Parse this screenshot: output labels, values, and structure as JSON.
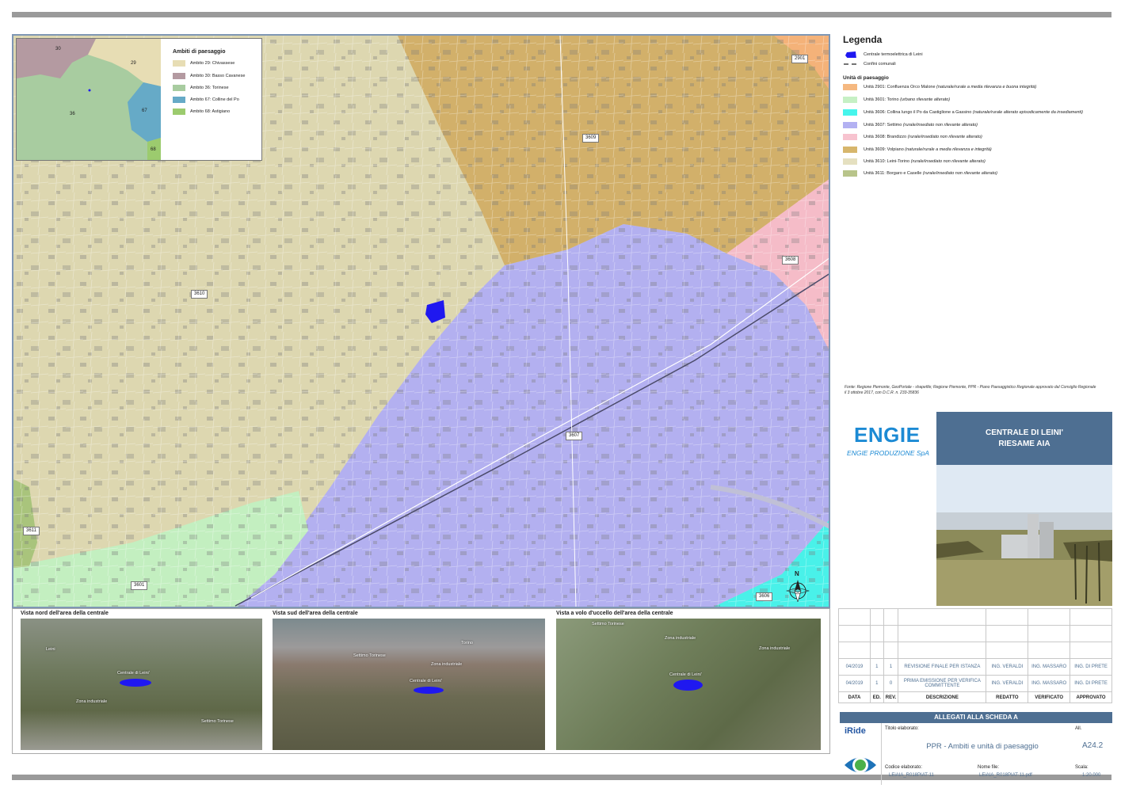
{
  "map": {
    "unit_labels": [
      "3610",
      "3609",
      "3607",
      "3608",
      "3601",
      "3611",
      "3606",
      "2901"
    ],
    "north_label": "N"
  },
  "inset": {
    "title": "Ambiti di paesaggio",
    "numbers": [
      "30",
      "29",
      "36",
      "67",
      "68"
    ],
    "items": [
      {
        "label": "Ambito 29: Chivassese",
        "color": "#e7ddb4"
      },
      {
        "label": "Ambito 30: Basso Cavanese",
        "color": "#b49aa1"
      },
      {
        "label": "Ambito 36: Torinese",
        "color": "#a8cca0"
      },
      {
        "label": "Ambito 67: Colline del Po",
        "color": "#66aac7"
      },
      {
        "label": "Ambito 68: Astigiano",
        "color": "#9ccb6e"
      }
    ]
  },
  "legend": {
    "title": "Legenda",
    "centrale": "Centrale termoelettrica di Leini",
    "confini": "Confini comunali",
    "units_title": "Unità di paesaggio",
    "units": [
      {
        "label": "Unità 2901: Confluenza Orco Malone",
        "note": "(naturale/rurale a media rilevanza e buona integrità)",
        "color": "#f5b880"
      },
      {
        "label": "Unità 3601: Torino",
        "note": "(urbano rilevante alterato)",
        "color": "#c6f0c4"
      },
      {
        "label": "Unità 3606: Collina lungo il Po da Castiglione a Gassino",
        "note": "(naturale/rurale alterato episodicamente da insediamenti)",
        "color": "#46f5ec"
      },
      {
        "label": "Unità 3607: Settimo",
        "note": "(rurale/insediato non rilevante alterato)",
        "color": "#b3b1f2"
      },
      {
        "label": "Unità 3608: Brandizzo",
        "note": "(rurale/insediato non rilevante alterato)",
        "color": "#f7c3cf"
      },
      {
        "label": "Unità 3609: Volpiano",
        "note": "(naturale/rurale a media rilevanza e integrità)",
        "color": "#d7b66c"
      },
      {
        "label": "Unità 3610: Leini-Torino",
        "note": "(rurale/insediato non rilevante alterato)",
        "color": "#e5e0c0"
      },
      {
        "label": "Unità 3611: Borgaro e Caselle",
        "note": "(rurale/insediato non rilevante alterato)",
        "color": "#b8c48a"
      }
    ],
    "source": "Fonte: Regione Piemonte, GeoPortale - shapefile; Regione Piemonte, PPR - Piano Paesaggistico Regionale approvato dal Consiglio Regionale il 3 ottobre 2017, con D.C.R. n. 233-35836"
  },
  "company": {
    "logo": "ENGIE",
    "name": "ENGIE PRODUZIONE SpA"
  },
  "project": {
    "line1": "CENTRALE DI LEINI'",
    "line2": "RIESAME AIA"
  },
  "views": [
    {
      "title": "Vista nord dell'area della centrale",
      "labels": [
        "Leini",
        "Centrale di Leini'",
        "Zona industriale",
        "Settimo Torinese"
      ]
    },
    {
      "title": "Vista sud dell'area della centrale",
      "labels": [
        "Torino",
        "Settimo Torinese",
        "Zona industriale",
        "Centrale di Leini'"
      ]
    },
    {
      "title": "Vista a volo d'uccello dell'area della centrale",
      "labels": [
        "Settimo Torinese",
        "Zona industriale",
        "Zona industriale",
        "Centrale di Leini'"
      ]
    }
  ],
  "revisions": {
    "rows": [
      {
        "data": "04/2019",
        "ed": "1",
        "rev": "1",
        "descrizione": "REVISIONE FINALE PER ISTANZA",
        "redatto": "ING. VERALDI",
        "verificato": "ING. MASSARO",
        "approvato": "ING. DI PRETE"
      },
      {
        "data": "04/2019",
        "ed": "1",
        "rev": "0",
        "descrizione": "PRIMA EMISSIONE PER VERIFICA COMMITTENTE",
        "redatto": "ING. VERALDI",
        "verificato": "ING. MASSARO",
        "approvato": "ING. DI PRETE"
      }
    ],
    "headers": [
      "DATA",
      "ED.",
      "REV.",
      "DESCRIZIONE",
      "REDATTO",
      "VERIFICATO",
      "APPROVATO"
    ]
  },
  "title_block": {
    "allegati": "ALLEGATI ALLA SCHEDA A",
    "logo": "iRide",
    "titolo_label": "Titolo elaborato:",
    "titolo": "PPR - Ambiti e unità di paesaggio",
    "all_label": "All.",
    "all_value": "A24.2",
    "codice_label": "Codice elaborato:",
    "codice": "LEiAIA_R018PIAT-11",
    "file_label": "Nome file:",
    "file": "LEiAIA_R018PIAT-11.pdf",
    "scala_label": "Scala:",
    "scala": "1:20.000"
  }
}
